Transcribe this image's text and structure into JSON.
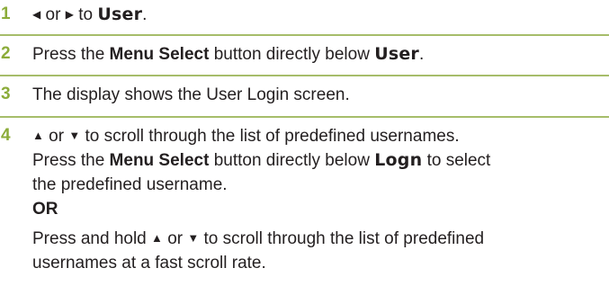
{
  "steps": [
    {
      "number": "1",
      "parts": {
        "icon_left": "◀",
        "or": "or",
        "icon_right": "▶",
        "to": "to",
        "display_word": "User",
        "period": "."
      }
    },
    {
      "number": "2",
      "parts": {
        "pre": "Press the",
        "button": "Menu Select",
        "mid": "button directly below",
        "display_word": "User",
        "period": "."
      }
    },
    {
      "number": "3",
      "text": "The display shows the User Login screen."
    },
    {
      "number": "4",
      "line1": {
        "up": "▲",
        "or": "or",
        "down": "▼",
        "rest": "to scroll through the list of predefined usernames."
      },
      "line2": {
        "pre": "Press the",
        "button": "Menu Select",
        "mid": "button directly below",
        "display_word": "Logn",
        "post": "to select"
      },
      "line3": "the predefined username.",
      "or_label": "OR",
      "line5": {
        "pre": "Press and hold",
        "up": "▲",
        "or": "or",
        "down": "▼",
        "rest": "to scroll through the list of predefined"
      },
      "line6": "usernames at a fast scroll rate."
    }
  ],
  "colors": {
    "step_number": "#8cac3a",
    "rule": "#a6bd6a",
    "text": "#231f20"
  }
}
